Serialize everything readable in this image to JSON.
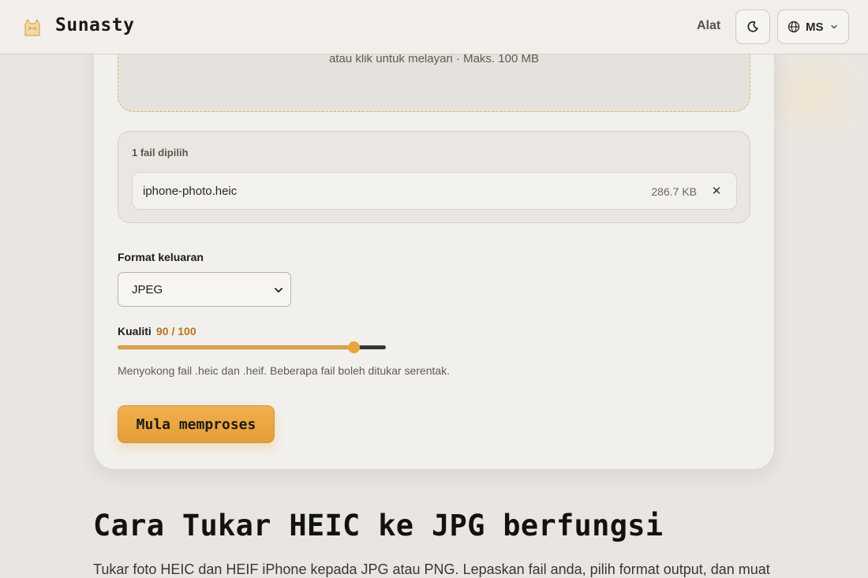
{
  "header": {
    "brand": "Sunasty",
    "nav_tools": "Alat",
    "language": "MS",
    "icons": {
      "logo": "cat-logo",
      "theme": "moon-icon",
      "language": "globe-icon",
      "dropdown": "chevron-down-icon"
    }
  },
  "dropzone": {
    "hint": "atau klik untuk melayari · Maks. 100 MB"
  },
  "files": {
    "count_label": "1 fail dipilih",
    "items": [
      {
        "name": "iphone-photo.heic",
        "size": "286.7 KB",
        "remove_icon": "close-icon",
        "remove_glyph": "✕"
      }
    ]
  },
  "output": {
    "format_label": "Format keluaran",
    "format_value": "JPEG",
    "quality_label": "Kualiti",
    "quality_value": "90 / 100",
    "quality_level": 90,
    "help_text": "Menyokong fail .heic dan .heif. Beberapa fail boleh ditukar serentak.",
    "start_label": "Mula memproses"
  },
  "section": {
    "heading": "Cara Tukar HEIC ke JPG berfungsi",
    "body": "Tukar foto HEIC dan HEIF iPhone kepada JPG atau PNG. Lepaskan fail anda, pilih format output, dan muat"
  },
  "colors": {
    "accent": "#e7a43f",
    "background": "#e9e6e1",
    "card": "#f2f0ec"
  }
}
